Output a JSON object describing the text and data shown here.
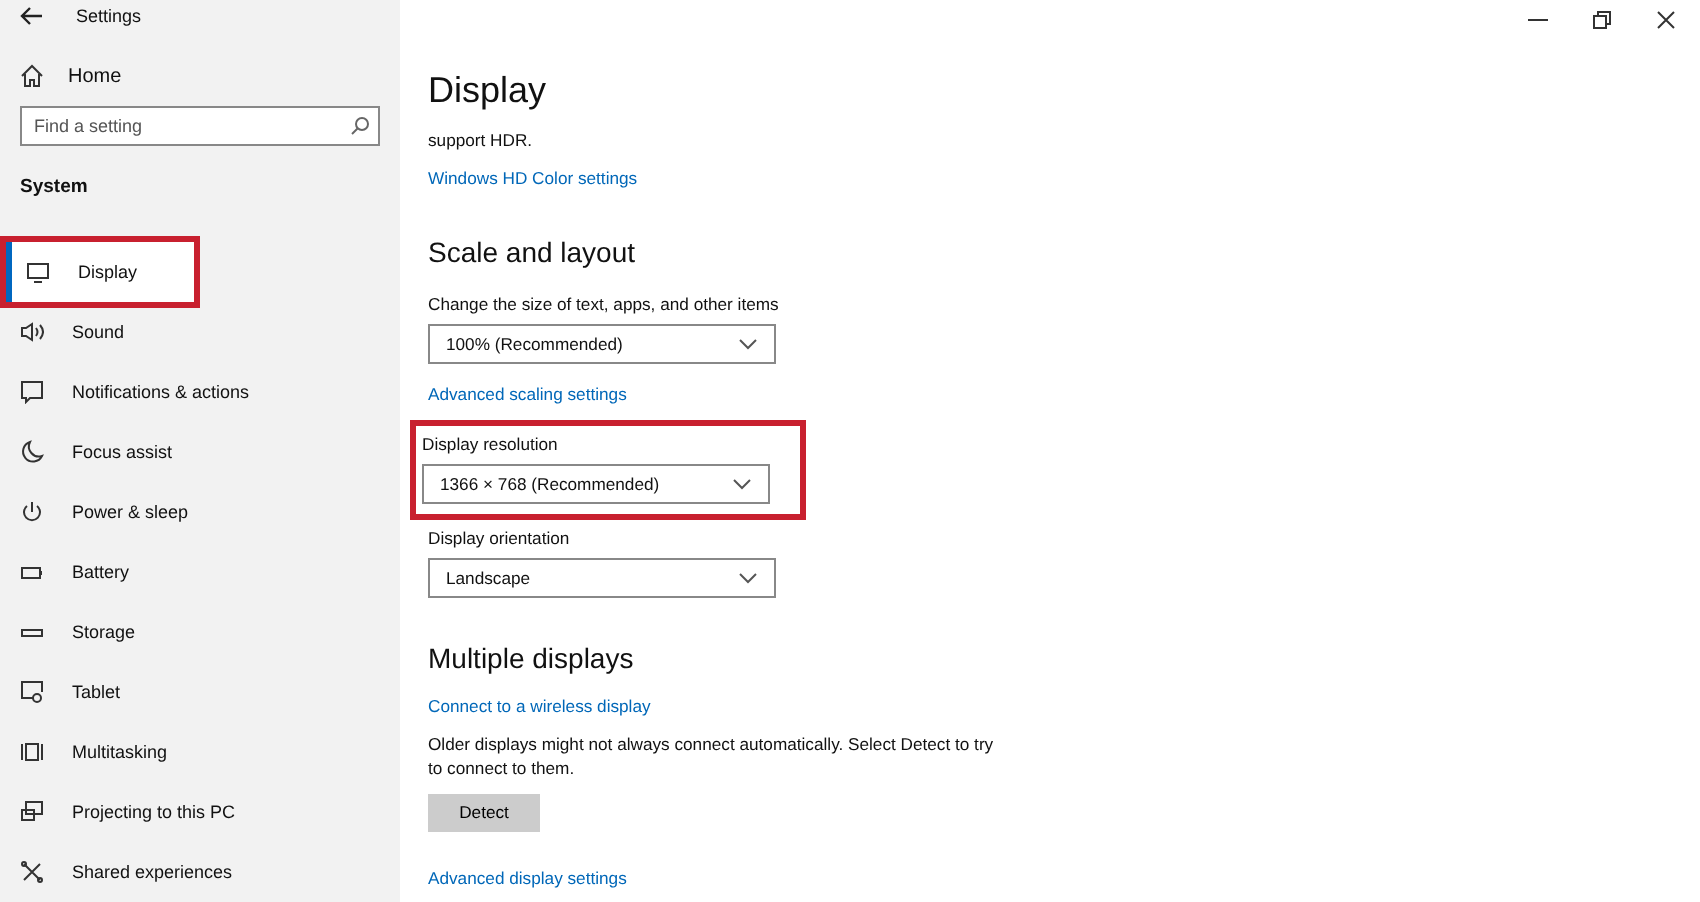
{
  "window": {
    "title": "Settings"
  },
  "sidebar": {
    "home": "Home",
    "search": {
      "placeholder": "Find a setting"
    },
    "section": "System",
    "items": [
      {
        "label": "Display",
        "selected": true,
        "highlighted": true
      },
      {
        "label": "Sound",
        "selected": false,
        "highlighted": false
      },
      {
        "label": "Notifications & actions",
        "selected": false,
        "highlighted": false
      },
      {
        "label": "Focus assist",
        "selected": false,
        "highlighted": false
      },
      {
        "label": "Power & sleep",
        "selected": false,
        "highlighted": false
      },
      {
        "label": "Battery",
        "selected": false,
        "highlighted": false
      },
      {
        "label": "Storage",
        "selected": false,
        "highlighted": false
      },
      {
        "label": "Tablet",
        "selected": false,
        "highlighted": false
      },
      {
        "label": "Multitasking",
        "selected": false,
        "highlighted": false
      },
      {
        "label": "Projecting to this PC",
        "selected": false,
        "highlighted": false
      },
      {
        "label": "Shared experiences",
        "selected": false,
        "highlighted": false
      }
    ]
  },
  "page": {
    "title": "Display",
    "sections": [
      {
        "items": [
          {
            "kind": "text",
            "text": "support HDR."
          },
          {
            "kind": "link",
            "text": "Windows HD Color settings"
          }
        ]
      },
      {
        "heading": "Scale and layout",
        "items": [
          {
            "kind": "dropdown",
            "label": "Change the size of text, apps, and other items",
            "value": "100% (Recommended)",
            "highlighted": false
          },
          {
            "kind": "link",
            "text": "Advanced scaling settings"
          },
          {
            "kind": "dropdown",
            "label": "Display resolution",
            "value": "1366 × 768 (Recommended)",
            "highlighted": true
          },
          {
            "kind": "dropdown",
            "label": "Display orientation",
            "value": "Landscape",
            "highlighted": false
          }
        ]
      },
      {
        "heading": "Multiple displays",
        "items": [
          {
            "kind": "link",
            "text": "Connect to a wireless display"
          },
          {
            "kind": "text",
            "text": "Older displays might not always connect automatically. Select Detect to try to connect to them."
          },
          {
            "kind": "button",
            "text": "Detect"
          },
          {
            "kind": "link",
            "text": "Advanced display settings"
          }
        ]
      }
    ]
  }
}
